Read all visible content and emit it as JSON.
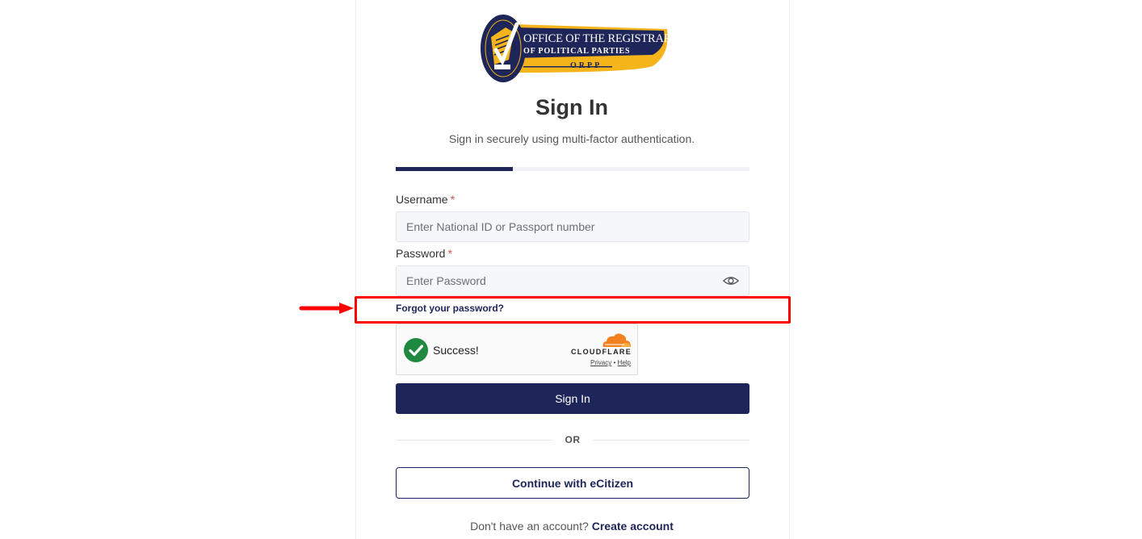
{
  "logo": {
    "line1": "OFFICE OF THE REGISTRAR",
    "line2": "OF POLITICAL PARTIES",
    "line3": "ORPP"
  },
  "header": {
    "title": "Sign In",
    "subtitle": "Sign in securely using multi-factor authentication."
  },
  "progress": {
    "fraction": 0.33
  },
  "form": {
    "username_label": "Username",
    "username_required": "*",
    "username_placeholder": "Enter National ID or Passport number",
    "username_value": "",
    "password_label": "Password",
    "password_required": "*",
    "password_placeholder": "Enter Password",
    "password_value": "",
    "password_toggle_icon": "eye-icon",
    "forgot_label": "Forgot your password?"
  },
  "captcha": {
    "status": "Success!",
    "brand": "CLOUDFLARE",
    "privacy_label": "Privacy",
    "separator": "•",
    "help_label": "Help"
  },
  "actions": {
    "sign_in_label": "Sign In",
    "divider_label": "OR",
    "ecitizen_label": "Continue with eCitizen"
  },
  "footer": {
    "prompt": "Don't have an account?",
    "create_label": "Create account"
  },
  "colors": {
    "brand_navy": "#1e2558",
    "brand_gold": "#f4b41a",
    "highlight": "#ff0000",
    "success_green": "#1f8a3f",
    "cloudflare_orange": "#f48120"
  }
}
